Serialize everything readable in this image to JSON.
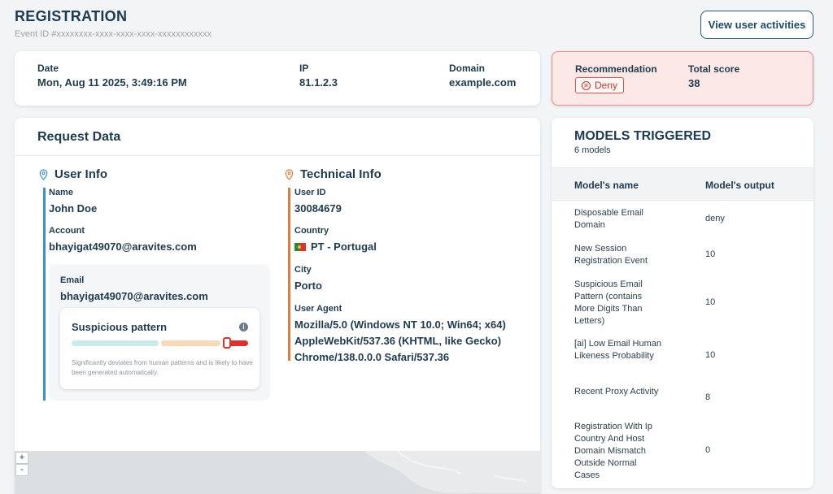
{
  "header": {
    "title": "REGISTRATION",
    "event_id": "Event ID  #xxxxxxxx-xxxx-xxxx-xxxx-xxxxxxxxxxxx",
    "view_button": "View user activities"
  },
  "summary": {
    "date_label": "Date",
    "date_value": "Mon, Aug 11 2025, 3:49:16 PM",
    "ip_label": "IP",
    "ip_value": "81.1.2.3",
    "domain_label": "Domain",
    "domain_value": "example.com"
  },
  "recommendation": {
    "label": "Recommendation",
    "value": "Deny",
    "score_label": "Total score",
    "score_value": "38",
    "color": "#c0392b"
  },
  "request": {
    "title": "Request Data",
    "user_info": {
      "title": "User Info",
      "name_label": "Name",
      "name_value": "John Doe",
      "account_label": "Account",
      "account_value": "bhayigat49070@aravites.com",
      "email_label": "Email",
      "email_value": "bhayigat49070@aravites.com",
      "accent": "#3b8fd1"
    },
    "suspicious": {
      "title": "Suspicious pattern",
      "description": "Significantly deviates from human patterns and is likely to have been generated automatically.",
      "level": 0.9
    },
    "technical_info": {
      "title": "Technical Info",
      "user_id_label": "User ID",
      "user_id_value": "30084679",
      "country_label": "Country",
      "country_value": "PT - Portugal",
      "city_label": "City",
      "city_value": "Porto",
      "user_agent_label": "User Agent",
      "user_agent_value": "Mozilla/5.0 (Windows NT 10.0; Win64; x64) AppleWebKit/537.36 (KHTML, like Gecko) Chrome/138.0.0.0 Safari/537.36",
      "accent": "#e07b39"
    },
    "map_zoom": {
      "in": "+",
      "out": "-"
    }
  },
  "models": {
    "title": "MODELS TRIGGERED",
    "subtitle": "6 models",
    "col_name": "Model's name",
    "col_output": "Model's output",
    "rows": [
      {
        "name": "Disposable Email Domain",
        "output": "deny"
      },
      {
        "name": "New Session Registration Event",
        "output": "10"
      },
      {
        "name": "Suspicious Email Pattern (contains More Digits Than Letters)",
        "output": "10"
      },
      {
        "name": "[ai] Low Email Human Likeness Probability",
        "output": "10"
      },
      {
        "name": "Recent Proxy Activity",
        "output": "8"
      },
      {
        "name": "Registration With Ip Country And Host Domain Mismatch Outside Normal Cases",
        "output": "0"
      }
    ]
  }
}
